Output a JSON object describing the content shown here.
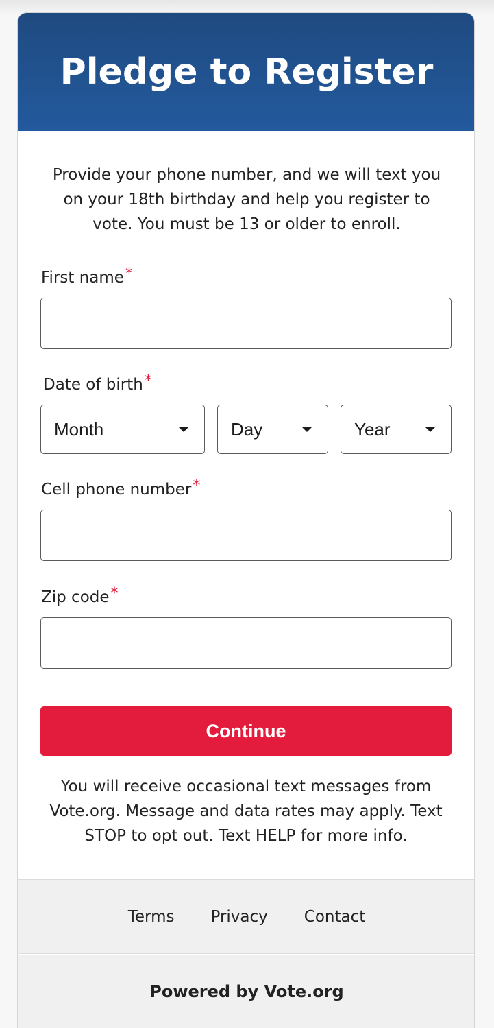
{
  "header": {
    "title": "Pledge to Register"
  },
  "intro": "Provide your phone number, and we will text you on your 18th birthday and help you register to vote. You must be 13 or older to enroll.",
  "required_marker": "*",
  "form": {
    "first_name": {
      "label": "First name",
      "value": ""
    },
    "dob": {
      "label": "Date of birth",
      "month": "Month",
      "day": "Day",
      "year": "Year"
    },
    "phone": {
      "label": "Cell phone number",
      "value": ""
    },
    "zip": {
      "label": "Zip code",
      "value": ""
    }
  },
  "continue_label": "Continue",
  "disclaimer": "You will receive occasional text messages from Vote.org. Message and data rates may apply. Text STOP to opt out. Text HELP for more info.",
  "footer": {
    "links": [
      "Terms",
      "Privacy",
      "Contact"
    ],
    "powered": "Powered by Vote.org"
  },
  "colors": {
    "header": "#235a9e",
    "accent": "#e31c3d"
  }
}
